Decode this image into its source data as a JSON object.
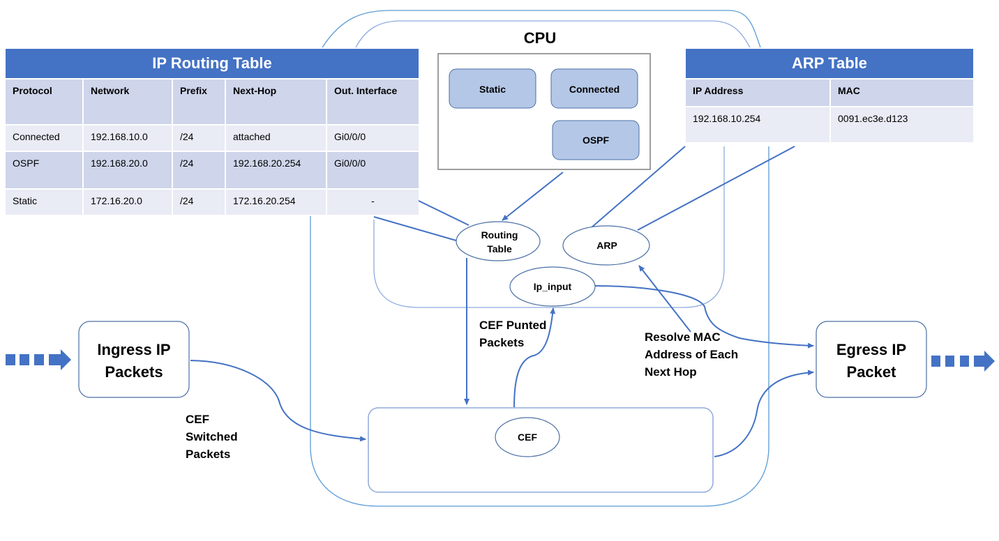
{
  "routing_table": {
    "title": "IP Routing Table",
    "columns": [
      "Protocol",
      "Network",
      "Prefix",
      "Next-Hop",
      "Out. Interface"
    ],
    "rows": [
      [
        "Connected",
        "192.168.10.0",
        "/24",
        "attached",
        "Gi0/0/0"
      ],
      [
        "OSPF",
        "192.168.20.0",
        "/24",
        "192.168.20.254",
        "Gi0/0/0"
      ],
      [
        "Static",
        "172.16.20.0",
        "/24",
        "172.16.20.254",
        "-"
      ]
    ]
  },
  "arp_table": {
    "title": "ARP Table",
    "columns": [
      "IP Address",
      "MAC"
    ],
    "rows": [
      [
        "192.168.10.254",
        "0091.ec3e.d123"
      ]
    ]
  },
  "cpu": {
    "title": "CPU",
    "sources": [
      "Static",
      "Connected",
      "OSPF"
    ]
  },
  "nodes": {
    "routing_table": [
      "Routing",
      "Table"
    ],
    "arp": "ARP",
    "ip_input": "Ip_input",
    "cef": "CEF",
    "ingress": [
      "Ingress IP",
      "Packets"
    ],
    "egress": [
      "Egress IP",
      "Packet"
    ]
  },
  "labels": {
    "cef_punted": [
      "CEF Punted",
      "Packets"
    ],
    "cef_switched": [
      "CEF",
      "Switched",
      "Packets"
    ],
    "resolve_mac": [
      "Resolve MAC",
      "Address of Each",
      "Next Hop"
    ]
  },
  "colors": {
    "accent": "#4472C4",
    "outline": "#5B9BD5",
    "header_fill": "#CFD5EA",
    "row_fill": "#E9EBF5",
    "cpu_source_fill": "#B4C7E7"
  }
}
